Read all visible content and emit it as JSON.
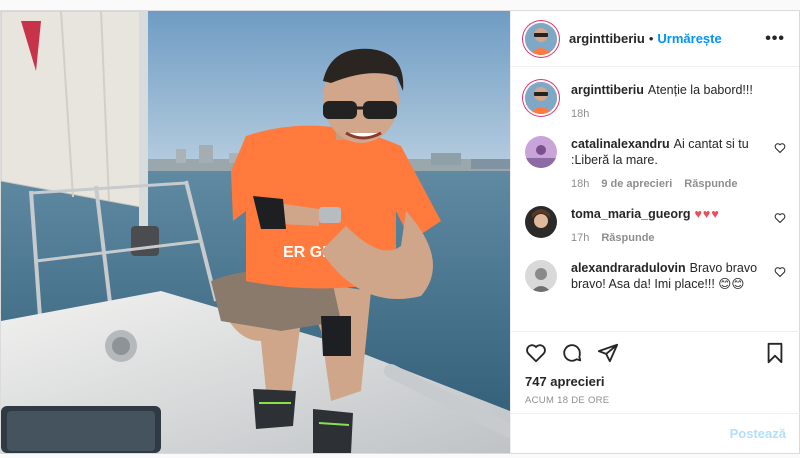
{
  "header": {
    "username": "arginttiberiu",
    "separator": "•",
    "follow_label": "Urmărește",
    "more_label": "•••"
  },
  "caption": {
    "username": "arginttiberiu",
    "text": "Atenție la babord!!!",
    "time": "18h"
  },
  "comments": [
    {
      "username": "catalinalexandru",
      "text": "Ai cantat si tu :Liberă la mare.",
      "time": "18h",
      "likes": "9 de aprecieri",
      "reply_label": "Răspunde"
    },
    {
      "username": "toma_maria_gueorg",
      "text": "♥♥♥",
      "time": "17h",
      "reply_label": "Răspunde"
    },
    {
      "username": "alexandraradulovin",
      "text": "Bravo bravo bravo! Asa da! Imi place!!! 😊😊"
    }
  ],
  "actions": {
    "likes": "747 aprecieri",
    "timestamp": "ACUM 18 DE ORE",
    "post_label": "Postează"
  },
  "colors": {
    "accent": "#0095f6",
    "heart": "#ed4956",
    "shirt": "#ff7a3c",
    "sky": "#7fa7c6",
    "water": "#3d6e8c"
  },
  "image": {
    "shirt_text": "ER GIVER"
  }
}
